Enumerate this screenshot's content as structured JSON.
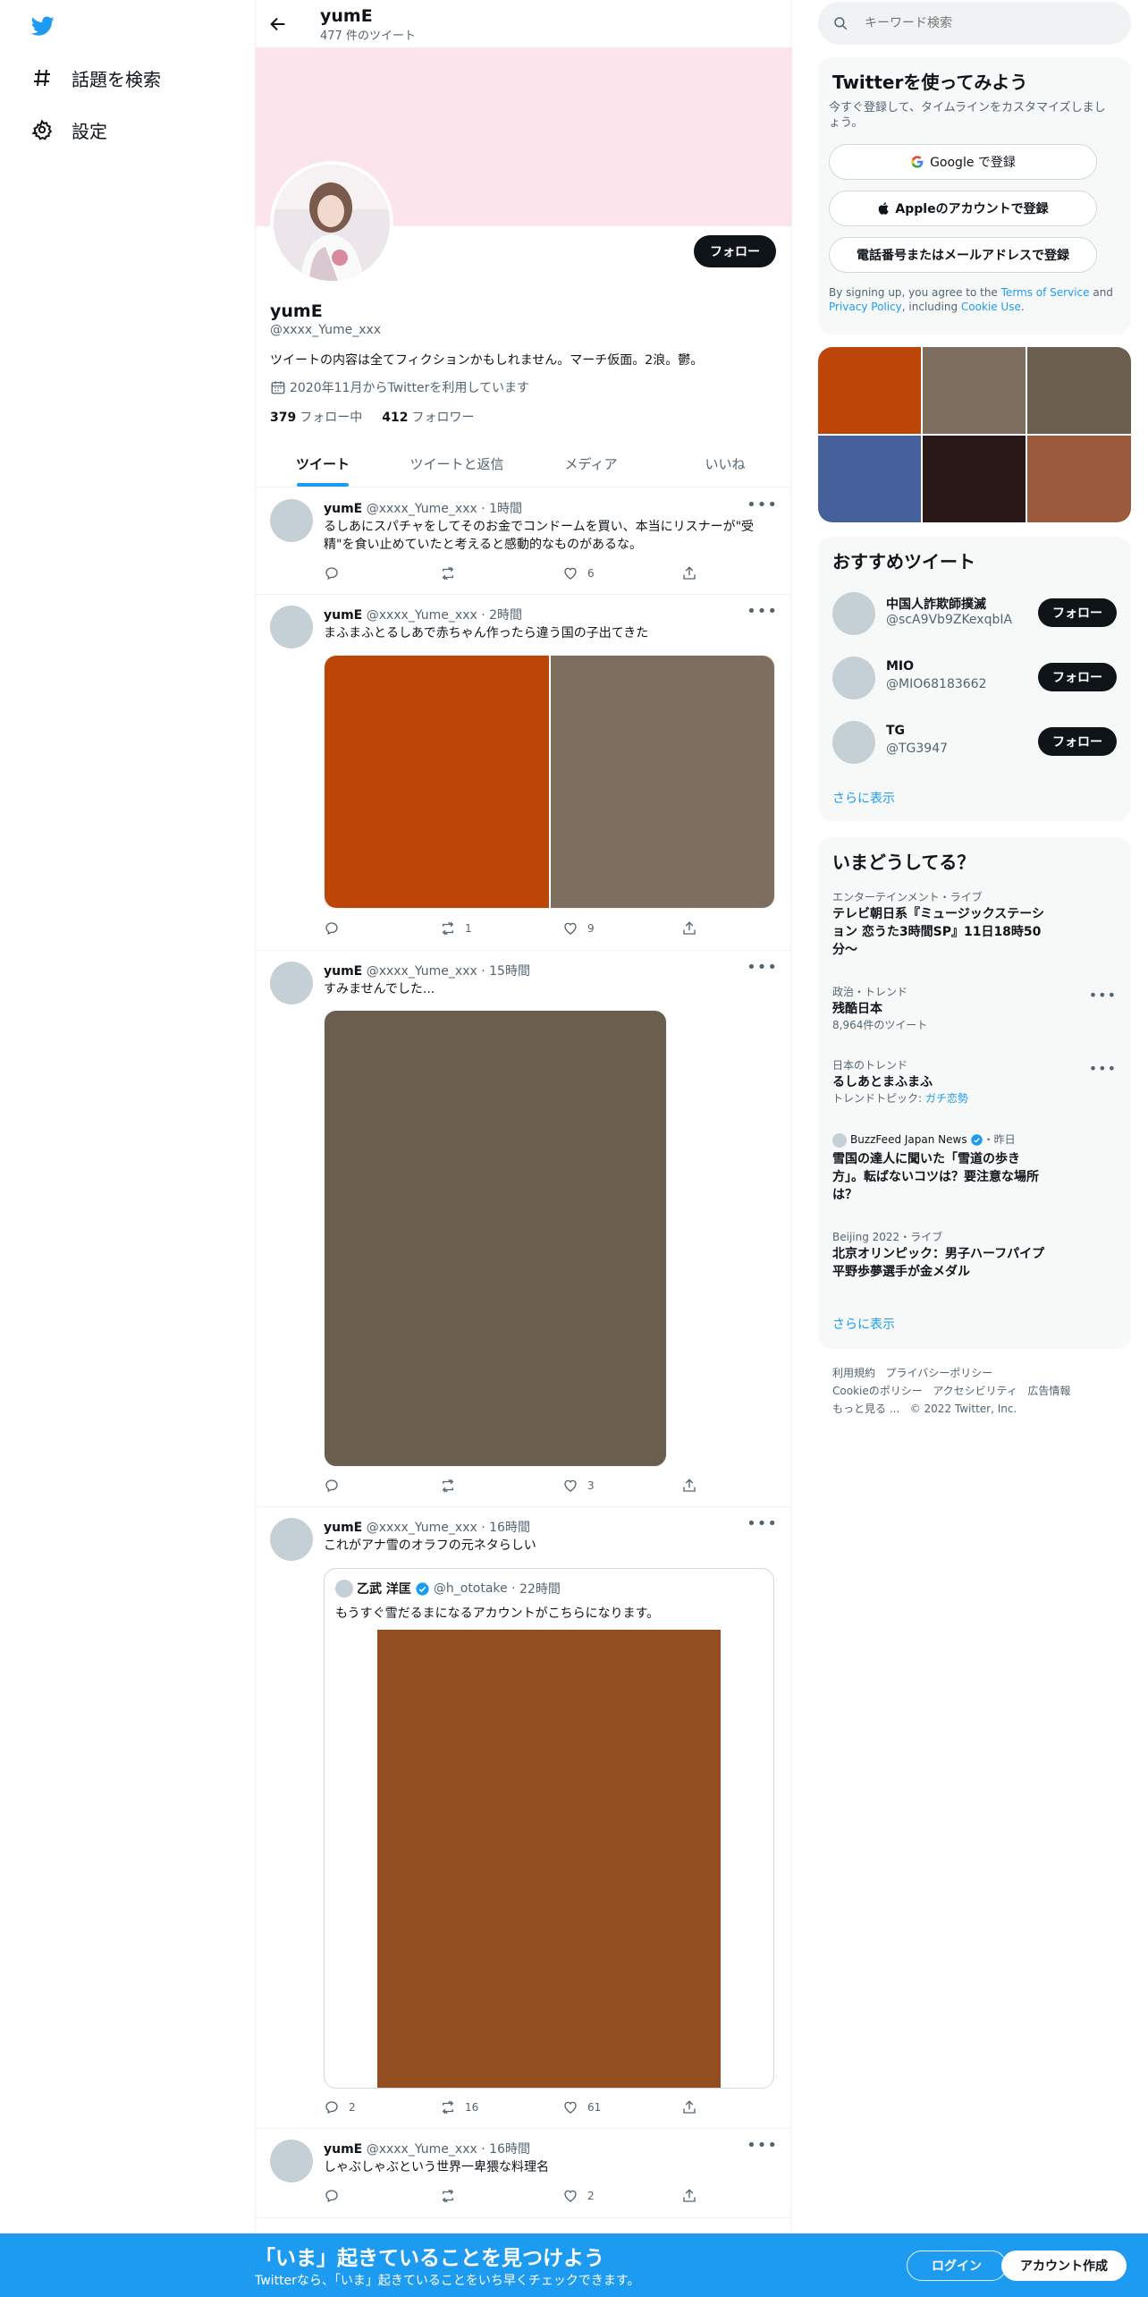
{
  "sidebar": {
    "explore_label": "話題を検索",
    "settings_label": "設定"
  },
  "profile": {
    "header_name": "yumE",
    "tweet_count": "477 件のツイート",
    "name": "yumE",
    "handle": "@xxxx_Yume_xxx",
    "bio": "ツイートの内容は全てフィクションかもしれません。マーチ仮面。2浪。鬱。",
    "joined": "2020年11月からTwitterを利用しています",
    "following_count": "379",
    "following_label": "フォロー中",
    "followers_count": "412",
    "followers_label": "フォロワー",
    "follow_label": "フォロー"
  },
  "tabs": [
    "ツイート",
    "ツイートと返信",
    "メディア",
    "いいね"
  ],
  "tweets": [
    {
      "name": "yumE",
      "handle": "@xxxx_Yume_xxx",
      "time": "1時間",
      "text": "るしあにスパチャをしてそのお金でコンドームを買い、本当にリスナーが\"受精\"を食い止めていたと考えると感動的なものがあるな。",
      "retweets": "",
      "likes": "6"
    },
    {
      "name": "yumE",
      "handle": "@xxxx_Yume_xxx",
      "time": "2時間",
      "text": "まふまふとるしあで赤ちゃん作ったら違う国の子出てきた",
      "retweets": "1",
      "likes": "9"
    },
    {
      "name": "yumE",
      "handle": "@xxxx_Yume_xxx",
      "time": "15時間",
      "text": "すみませんでした...",
      "retweets": "",
      "likes": "3"
    },
    {
      "name": "yumE",
      "handle": "@xxxx_Yume_xxx",
      "time": "16時間",
      "text": "これがアナ雪のオラフの元ネタらしい",
      "replies": "2",
      "retweets": "16",
      "likes": "61",
      "quote": {
        "name": "乙武 洋匡",
        "handle": "@h_ototake",
        "time": "22時間",
        "text": "もうすぐ雪だるまになるアカウントがこちらになります。"
      }
    },
    {
      "name": "yumE",
      "handle": "@xxxx_Yume_xxx",
      "time": "16時間",
      "text": "しゃぶしゃぶという世界一卑猥な料理名",
      "retweets": "",
      "likes": "2"
    }
  ],
  "search": {
    "placeholder": "キーワード検索"
  },
  "signup": {
    "title": "Twitterを使ってみよう",
    "desc": "今すぐ登録して、タイムラインをカスタマイズしましょう。",
    "google": "Google で登録",
    "apple": "Appleのアカウントで登録",
    "phone": "電話番号またはメールアドレスで登録",
    "legal_1": "By signing up, you agree to the ",
    "terms": "Terms of Service",
    "legal_2": " and ",
    "privacy": "Privacy Policy",
    "legal_3": ", including ",
    "cookie": "Cookie Use",
    "legal_4": "."
  },
  "recommended": {
    "title": "おすすめツイート",
    "users": [
      {
        "name": "中国人詐欺師撲滅",
        "handle": "@scA9Vb9ZKexqbIA"
      },
      {
        "name": "MIO",
        "handle": "@MIO68183662"
      },
      {
        "name": "TG",
        "handle": "@TG3947"
      }
    ],
    "follow_label": "フォロー",
    "more": "さらに表示"
  },
  "trends": {
    "title": "いまどうしてる？",
    "items": [
      {
        "meta": "エンターテインメント・ライブ",
        "title": "テレビ朝日系『ミュージックステーション 恋うた3時間SP』11日18時50分〜",
        "sub": ""
      },
      {
        "meta": "政治・トレンド",
        "title": "残酷日本",
        "sub": "8,964件のツイート"
      },
      {
        "meta": "日本のトレンド",
        "title": "るしあとまふまふ",
        "sub_prefix": "トレンドトピック: ",
        "sub_link": "ガチ恋勢"
      },
      {
        "meta_source": "BuzzFeed Japan News",
        "meta_time": "・昨日",
        "title": "雪国の達人に聞いた「雪道の歩き方」。転ばないコツは？要注意な場所は？"
      },
      {
        "meta": "Beijing 2022・ライブ",
        "title": "北京オリンピック：男子ハーフパイプ 平野歩夢選手が金メダル"
      }
    ],
    "more": "さらに表示"
  },
  "footer": {
    "terms": "利用規約",
    "privacy": "プライバシーポリシー",
    "cookie": "Cookieのポリシー",
    "accessibility": "アクセシビリティ",
    "ads": "広告情報",
    "more": "もっと見る ...",
    "copyright": "© 2022 Twitter, Inc."
  },
  "bottom": {
    "title": "「いま」起きていることを見つけよう",
    "sub": "Twitterなら、「いま」起きていることをいち早くチェックできます。",
    "login": "ログイン",
    "signup": "アカウント作成"
  },
  "colors": {
    "accent": "#1d9bf0",
    "banner": "#fbe4ec",
    "media_1": "#bd4508",
    "media_2": "#7e6e5f",
    "media_3": "#6a5e4f",
    "media_4": "#934f22",
    "grid": [
      "#bd4508",
      "#7e6e5f",
      "#6a5e4f",
      "#45609a",
      "#2a1818",
      "#9a5a3b"
    ]
  }
}
